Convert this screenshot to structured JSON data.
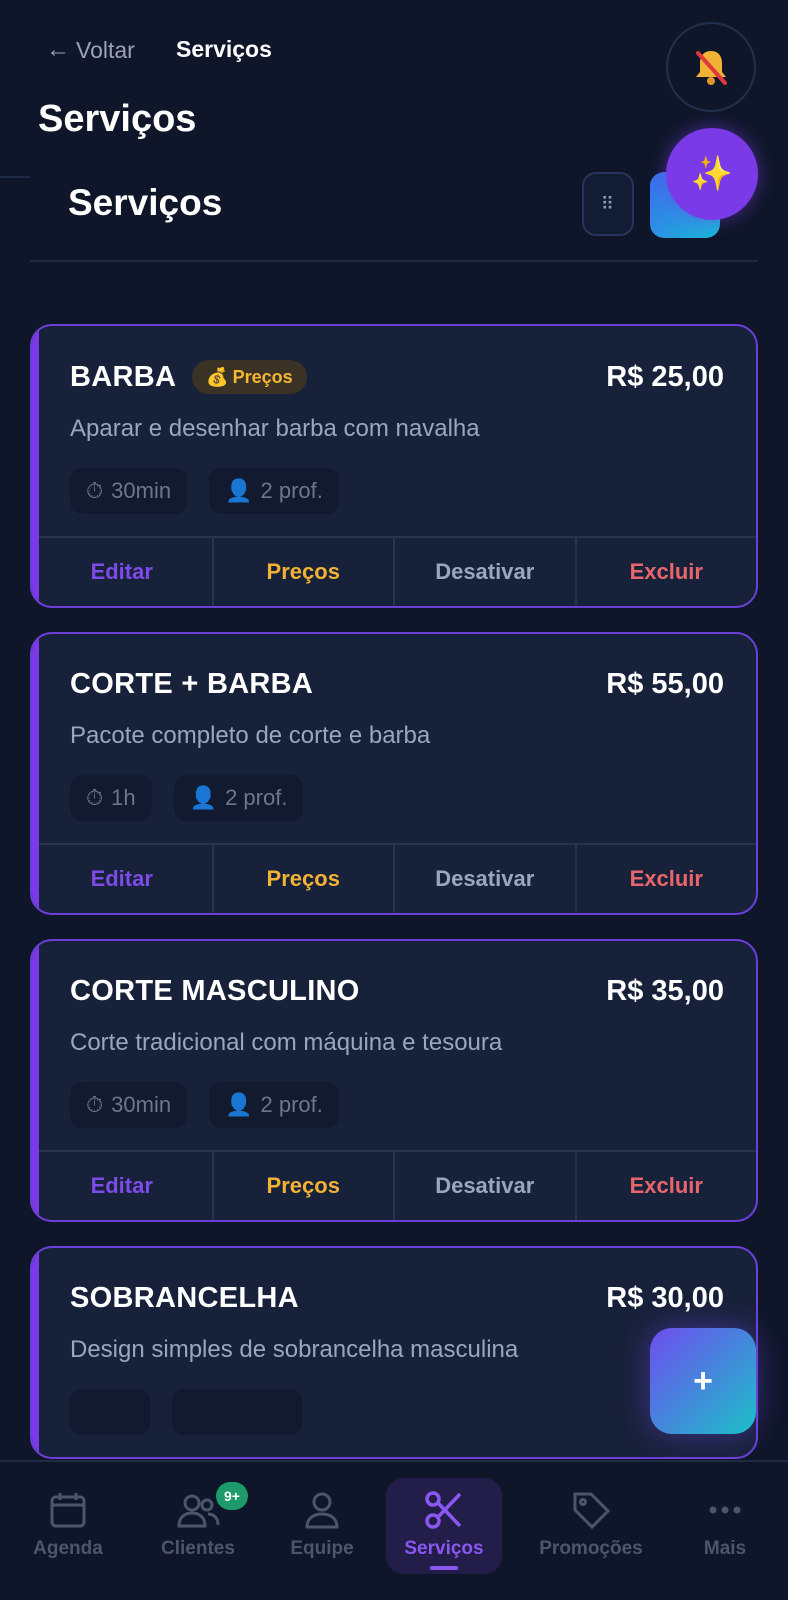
{
  "header": {
    "back_label": "Voltar",
    "breadcrumb": "Serviços",
    "page_title": "Serviços",
    "bell_icon": "bell-off-icon"
  },
  "section": {
    "title": "Serviços",
    "drag_icon": "drag-handle-icon",
    "ai_icon": "sparkles-icon"
  },
  "services": [
    {
      "name": "BARBA",
      "price": "R$ 25,00",
      "badge": "Preços",
      "description": "Aparar e desenhar barba com navalha",
      "duration": "30min",
      "professionals": "2 prof."
    },
    {
      "name": "CORTE + BARBA",
      "price": "R$ 55,00",
      "badge": "",
      "description": "Pacote completo de corte e barba",
      "duration": "1h",
      "professionals": "2 prof."
    },
    {
      "name": "CORTE MASCULINO",
      "price": "R$ 35,00",
      "badge": "",
      "description": "Corte tradicional com máquina e tesoura",
      "duration": "30min",
      "professionals": "2 prof."
    },
    {
      "name": "SOBRANCELHA",
      "price": "R$ 30,00",
      "badge": "",
      "description": "Design simples de sobrancelha masculina",
      "duration": "",
      "professionals": ""
    }
  ],
  "actions": {
    "edit": "Editar",
    "prices": "Preços",
    "deactivate": "Desativar",
    "delete": "Excluir"
  },
  "fab": {
    "label": "+"
  },
  "nav": {
    "items": [
      {
        "label": "Agenda",
        "icon": "calendar-icon"
      },
      {
        "label": "Clientes",
        "icon": "users-icon",
        "badge": "9+"
      },
      {
        "label": "Equipe",
        "icon": "user-icon"
      },
      {
        "label": "Serviços",
        "icon": "scissors-icon"
      },
      {
        "label": "Promoções",
        "icon": "tag-icon"
      },
      {
        "label": "Mais",
        "icon": "more-icon"
      }
    ]
  },
  "colors": {
    "background": "#0f1629",
    "card": "#18213a",
    "accent": "#7a3ae8",
    "price_action": "#f2b233",
    "delete_action": "#e8666b"
  }
}
